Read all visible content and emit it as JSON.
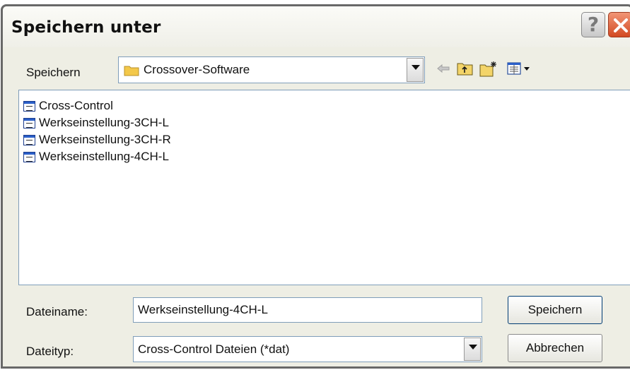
{
  "dialog": {
    "title": "Speichern unter"
  },
  "location": {
    "label": "Speichern",
    "folder": "Crossover-Software"
  },
  "files": [
    {
      "name": "Cross-Control"
    },
    {
      "name": "Werkseinstellung-3CH-L"
    },
    {
      "name": "Werkseinstellung-3CH-R"
    },
    {
      "name": "Werkseinstellung-4CH-L"
    }
  ],
  "filename": {
    "label": "Dateiname:",
    "value": "Werkseinstellung-4CH-L"
  },
  "filetype": {
    "label": "Dateityp:",
    "value": "Cross-Control Dateien (*dat)"
  },
  "buttons": {
    "save": "Speichern",
    "cancel": "Abbrechen",
    "help": "?"
  },
  "colors": {
    "dialog_bg": "#eeeee4",
    "border_blue": "#7f9db9",
    "close_red": "#d24a23",
    "folder_yellow": "#f3c84a"
  }
}
